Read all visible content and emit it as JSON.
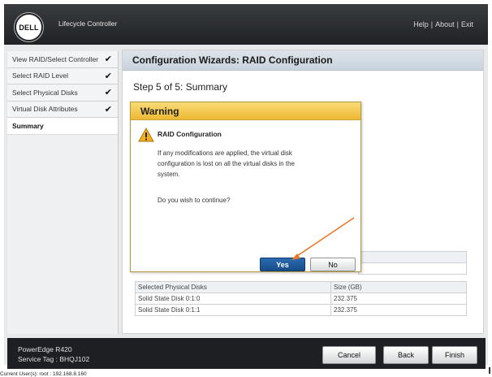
{
  "app": {
    "logo_text": "DELL",
    "title": "Lifecycle Controller",
    "links": [
      "Help",
      "About",
      "Exit"
    ],
    "link_separator": "|"
  },
  "sidebar": {
    "items": [
      {
        "label": "View RAID/Select Controller",
        "check": "✔"
      },
      {
        "label": "Select RAID Level",
        "check": "✔"
      },
      {
        "label": "Select Physical Disks",
        "check": "✔"
      },
      {
        "label": "Virtual Disk Attributes",
        "check": "✔"
      },
      {
        "label": "Summary",
        "check": ""
      }
    ]
  },
  "main": {
    "title": "Configuration Wizards: RAID Configuration",
    "step": "Step 5 of 5: Summary",
    "disks_table": {
      "headers": [
        "Selected Physical Disks",
        "Size (GB)"
      ],
      "rows": [
        [
          "Solid State Disk 0:1:0",
          "232.375"
        ],
        [
          "Solid State Disk 0:1:1",
          "232.375"
        ]
      ]
    }
  },
  "dialog": {
    "header": "Warning",
    "title": "RAID Configuration",
    "message": "If any modifications are applied, the virtual disk configuration is lost on all the virtual disks in the system.",
    "question": "Do you wish to continue?",
    "yes_label": "Yes",
    "no_label": "No"
  },
  "footer": {
    "model": "PowerEdge R420",
    "service_tag": "Service Tag : BHQJ102",
    "cancel_label": "Cancel",
    "back_label": "Back",
    "finish_label": "Finish"
  },
  "status_line": "Current User(s): root : 192.168.8.160",
  "colors": {
    "accent_blue": "#1f5aa0",
    "warning_yellow": "#f0c040",
    "arrow_orange": "#e8782a",
    "header_dark": "#2a2c2f"
  }
}
